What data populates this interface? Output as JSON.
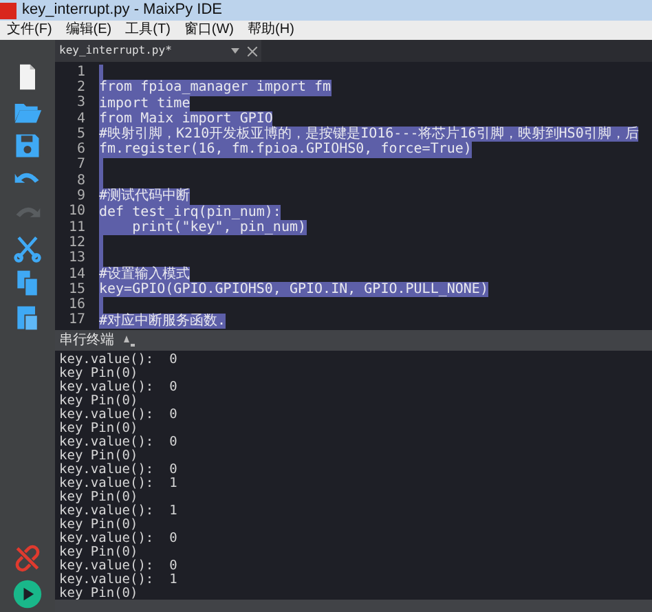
{
  "window": {
    "title": "key_interrupt.py - MaixPy IDE"
  },
  "menu": [
    "文件(F)",
    "编辑(E)",
    "工具(T)",
    "窗口(W)",
    "帮助(H)"
  ],
  "toolbar": [
    {
      "kind": "new",
      "disabled": false
    },
    {
      "kind": "open",
      "disabled": false
    },
    {
      "kind": "save",
      "disabled": false
    },
    {
      "kind": "undo",
      "disabled": false
    },
    {
      "kind": "redo",
      "disabled": true
    },
    {
      "kind": "cut",
      "disabled": false
    },
    {
      "kind": "copy",
      "disabled": false
    },
    {
      "kind": "paste",
      "disabled": false
    }
  ],
  "toolbar_bottom": [
    {
      "kind": "disconnect"
    },
    {
      "kind": "run"
    }
  ],
  "editor_tab": {
    "label": "key_interrupt.py*"
  },
  "code_lines": [
    {
      "number": "1",
      "selected": true
    },
    {
      "number": "2",
      "text": "from fpioa_manager import fm",
      "selected": true
    },
    {
      "number": "3",
      "text": "import time",
      "selected": true
    },
    {
      "number": "4",
      "text": "from Maix import GPIO",
      "selected": true
    },
    {
      "number": "5",
      "text": "#映射引脚，K210开发板亚博的，是按键是IO16---将芯片16引脚，映射到HS0引脚，后",
      "selected": true
    },
    {
      "number": "6",
      "text": "fm.register(16, fm.fpioa.GPIOHS0, force=True)",
      "selected": true
    },
    {
      "number": "7",
      "selected": true
    },
    {
      "number": "8",
      "selected": true
    },
    {
      "number": "9",
      "text": "#测试代码中断",
      "selected": true
    },
    {
      "number": "10",
      "text": "def test_irq(pin_num):",
      "selected": true
    },
    {
      "number": "11",
      "text": "    print(\"key\", pin_num)",
      "selected": true
    },
    {
      "number": "12",
      "selected": true
    },
    {
      "number": "13",
      "selected": true
    },
    {
      "number": "14",
      "text": "#设置输入模式",
      "selected": true
    },
    {
      "number": "15",
      "text": "key=GPIO(GPIO.GPIOHS0, GPIO.IN, GPIO.PULL_NONE)",
      "selected": true
    },
    {
      "number": "16",
      "selected": true
    },
    {
      "number": "17",
      "text": "#对应中断服务函数.",
      "selected": true
    }
  ],
  "serial_terminal": {
    "title": "串行终端",
    "output": [
      "key.value():  0",
      "key Pin(0)",
      "key.value():  0",
      "key Pin(0)",
      "key.value():  0",
      "key Pin(0)",
      "key.value():  0",
      "key Pin(0)",
      "key.value():  0",
      "key.value():  1",
      "key Pin(0)",
      "key.value():  1",
      "key Pin(0)",
      "key.value():  0",
      "key Pin(0)",
      "key.value():  0",
      "key.value():  1",
      "key Pin(0)"
    ]
  }
}
